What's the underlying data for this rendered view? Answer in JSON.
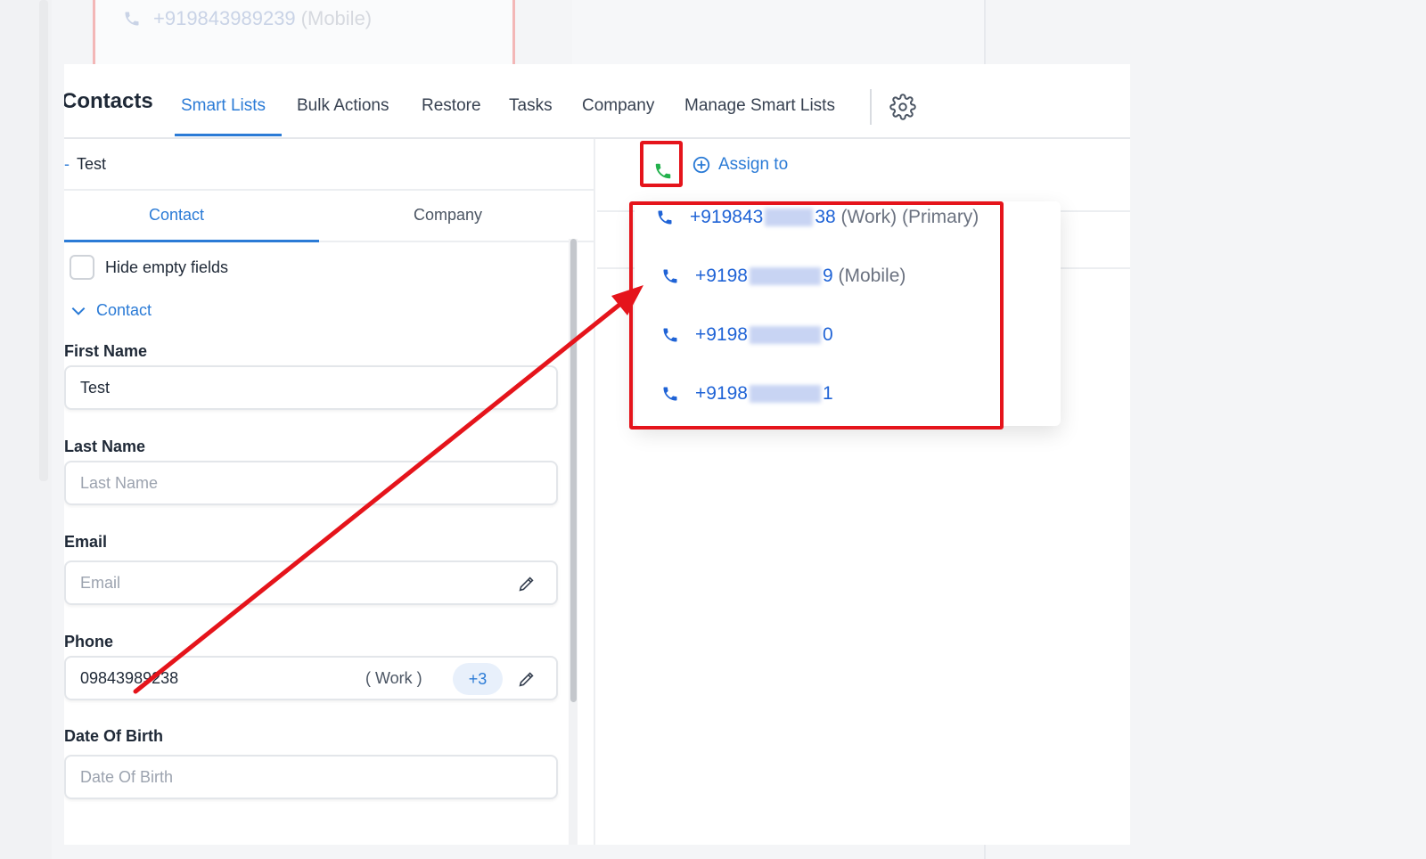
{
  "background": {
    "faded_phone": "+919843989239",
    "faded_phone_type": "(Mobile)"
  },
  "nav": {
    "title": "Contacts",
    "items": [
      "Smart Lists",
      "Bulk Actions",
      "Restore",
      "Tasks",
      "Company",
      "Manage Smart Lists"
    ],
    "active": "Smart Lists",
    "settings_icon": "gear-icon"
  },
  "breadcrumb": {
    "dash": "-",
    "name": "Test"
  },
  "subtabs": {
    "contact": "Contact",
    "company": "Company"
  },
  "options": {
    "hide_empty_fields": "Hide empty fields"
  },
  "section": {
    "title": "Contact"
  },
  "fields": {
    "first_name": {
      "label": "First Name",
      "value": "Test"
    },
    "last_name": {
      "label": "Last Name",
      "placeholder": "Last Name"
    },
    "email": {
      "label": "Email",
      "placeholder": "Email"
    },
    "phone": {
      "label": "Phone",
      "value": "09843989238",
      "type": "( Work )",
      "more": "+3"
    },
    "dob": {
      "label": "Date Of Birth",
      "placeholder": "Date Of Birth"
    }
  },
  "actions": {
    "assign_to": "Assign to"
  },
  "phone_dropdown": {
    "items": [
      {
        "prefix": "+919843",
        "suffix": "38",
        "tag": "(Work) (Primary)"
      },
      {
        "prefix": "+9198",
        "suffix": "9",
        "tag": "(Mobile)"
      },
      {
        "prefix": "+9198",
        "suffix": "0",
        "tag": ""
      },
      {
        "prefix": "+9198",
        "suffix": "1",
        "tag": ""
      }
    ]
  },
  "colors": {
    "accent": "#2b7bd6",
    "call_green": "#22b14c",
    "annotation_red": "#e5141b",
    "phone_blue": "#1f63d6"
  }
}
